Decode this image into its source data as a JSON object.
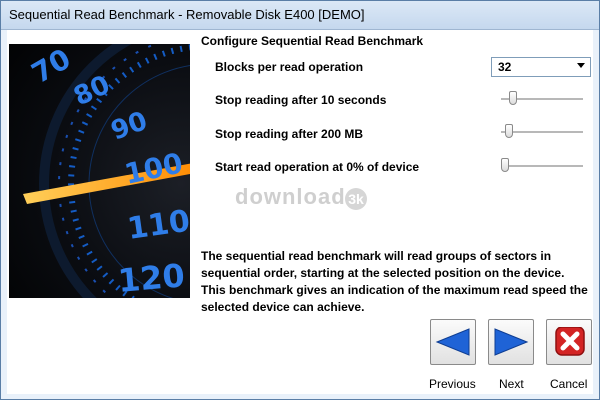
{
  "window": {
    "title": "Sequential Read Benchmark - Removable Disk  E400 [DEMO]"
  },
  "section_title": "Configure Sequential Read Benchmark",
  "settings": {
    "blocks": {
      "label": "Blocks per read operation",
      "value": "32"
    },
    "stop_seconds": {
      "label": "Stop reading after 10 seconds",
      "level": 0.1
    },
    "stop_mb": {
      "label": "Stop reading after 200 MB",
      "level": 0.05
    },
    "start_percent": {
      "label": "Start read operation at 0% of device",
      "level": 0.0
    }
  },
  "description": "The sequential read benchmark will read groups of sectors in sequential order, starting at the selected position on the device. This benchmark gives an indication of the maximum read speed the selected device can achieve.",
  "watermark": {
    "text": "download",
    "badge": "3k"
  },
  "buttons": {
    "previous": "Previous",
    "next": "Next",
    "cancel": "Cancel"
  },
  "speedometer": {
    "labels": [
      "70",
      "80",
      "90",
      "100",
      "110",
      "120"
    ]
  },
  "colors": {
    "accent_blue": "#1f63d6",
    "cancel_red": "#d32424",
    "needle_orange": "#ff9a1a"
  }
}
